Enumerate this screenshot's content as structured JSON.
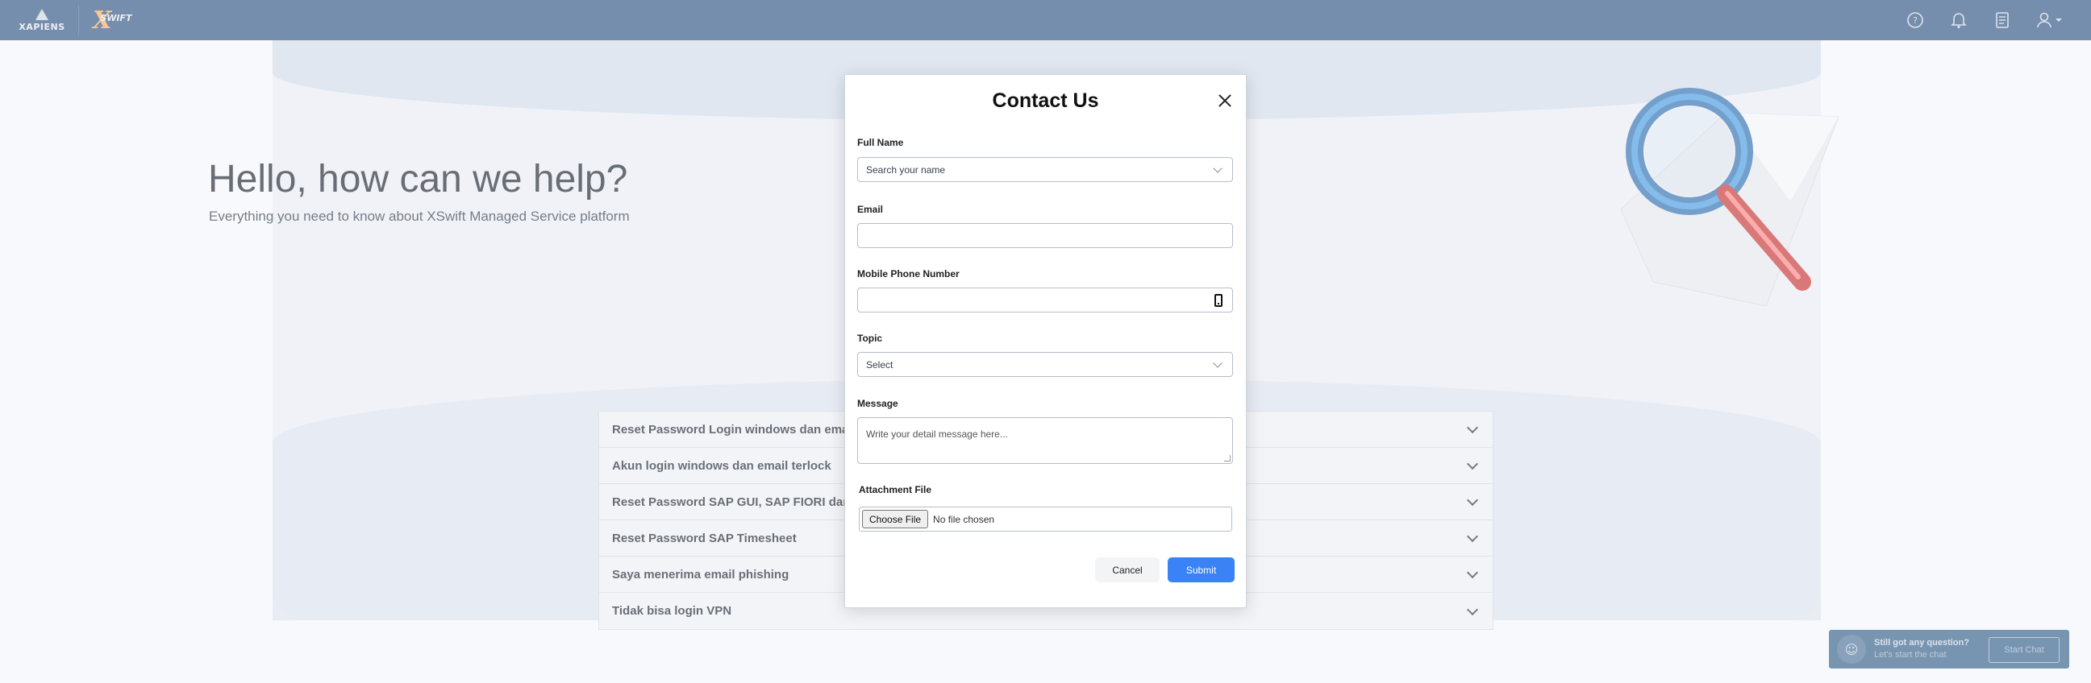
{
  "header": {
    "brand_primary": "XAPIENS",
    "brand_secondary": "SWIFT",
    "icons": [
      "help-icon",
      "bell-icon",
      "document-icon",
      "user-menu-icon"
    ]
  },
  "hero": {
    "title": "Hello, how can we help?",
    "subtitle": "Everything you need to know about XSwift Managed Service platform"
  },
  "faq": {
    "items": [
      {
        "label": "Reset Password Login windows dan email"
      },
      {
        "label": "Akun login windows dan email terlock"
      },
      {
        "label": "Reset Password SAP GUI, SAP FIORI dan SAP"
      },
      {
        "label": "Reset Password SAP Timesheet"
      },
      {
        "label": "Saya menerima email phishing"
      },
      {
        "label": "Tidak bisa login VPN"
      }
    ]
  },
  "chat": {
    "title": "Still got any question?",
    "subtitle": "Let's start the chat",
    "button": "Start Chat"
  },
  "modal": {
    "title": "Contact Us",
    "full_name": {
      "label": "Full Name",
      "placeholder": "Search your name"
    },
    "email": {
      "label": "Email",
      "value": ""
    },
    "phone": {
      "label": "Mobile Phone Number",
      "value": ""
    },
    "topic": {
      "label": "Topic",
      "selected": "Select"
    },
    "message": {
      "label": "Message",
      "placeholder": "Write your detail message here..."
    },
    "attachment": {
      "label": "Attachment File",
      "button": "Choose File",
      "status": "No file chosen"
    },
    "cancel": "Cancel",
    "submit": "Submit"
  },
  "colors": {
    "header_bg": "#2c5282",
    "accent": "#3b82f6",
    "logo_orange": "#f6ad55"
  }
}
